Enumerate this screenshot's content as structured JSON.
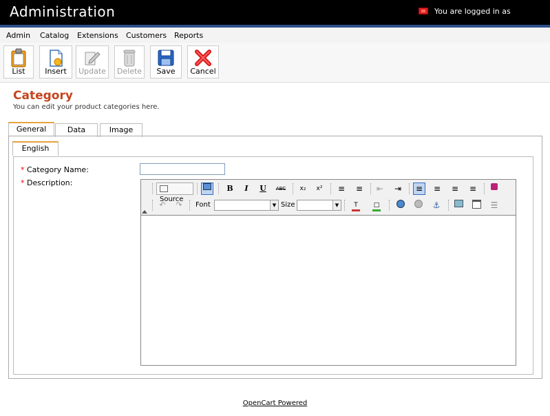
{
  "header": {
    "title": "Administration",
    "login_text": "You are logged in as"
  },
  "menu": {
    "items": [
      {
        "label": "Admin"
      },
      {
        "label": "Catalog"
      },
      {
        "label": "Extensions"
      },
      {
        "label": "Customers"
      },
      {
        "label": "Reports"
      }
    ]
  },
  "toolbar": {
    "buttons": [
      {
        "label": "List",
        "icon": "clipboard-icon",
        "enabled": true
      },
      {
        "label": "Insert",
        "icon": "new-document-icon",
        "enabled": true
      },
      {
        "label": "Update",
        "icon": "edit-icon",
        "enabled": false
      },
      {
        "label": "Delete",
        "icon": "trash-icon",
        "enabled": false
      },
      {
        "label": "Save",
        "icon": "floppy-disk-icon",
        "enabled": true
      },
      {
        "label": "Cancel",
        "icon": "red-x-icon",
        "enabled": true
      }
    ]
  },
  "page": {
    "heading": "Category",
    "description": "You can edit your product categories here."
  },
  "tabs": [
    {
      "label": "General",
      "active": true
    },
    {
      "label": "Data",
      "active": false
    },
    {
      "label": "Image",
      "active": false
    }
  ],
  "language_tab": {
    "label": "English"
  },
  "form": {
    "required_marker": "*",
    "category_name_label": "Category Name:",
    "category_name_value": "",
    "description_label": "Description:"
  },
  "editor": {
    "source_label": "Source",
    "font_label": "Font",
    "font_value": "",
    "size_label": "Size",
    "size_value": "",
    "bold": "B",
    "italic": "I",
    "underline": "U",
    "strike": "ABC",
    "subscript": "x₂",
    "superscript": "x²"
  },
  "footer": {
    "link": "OpenCart Powered"
  },
  "colors": {
    "heading": "#c4451f",
    "header_bg": "#000000",
    "accent_bar": "#2d4f8a",
    "required": "#ee0000"
  }
}
